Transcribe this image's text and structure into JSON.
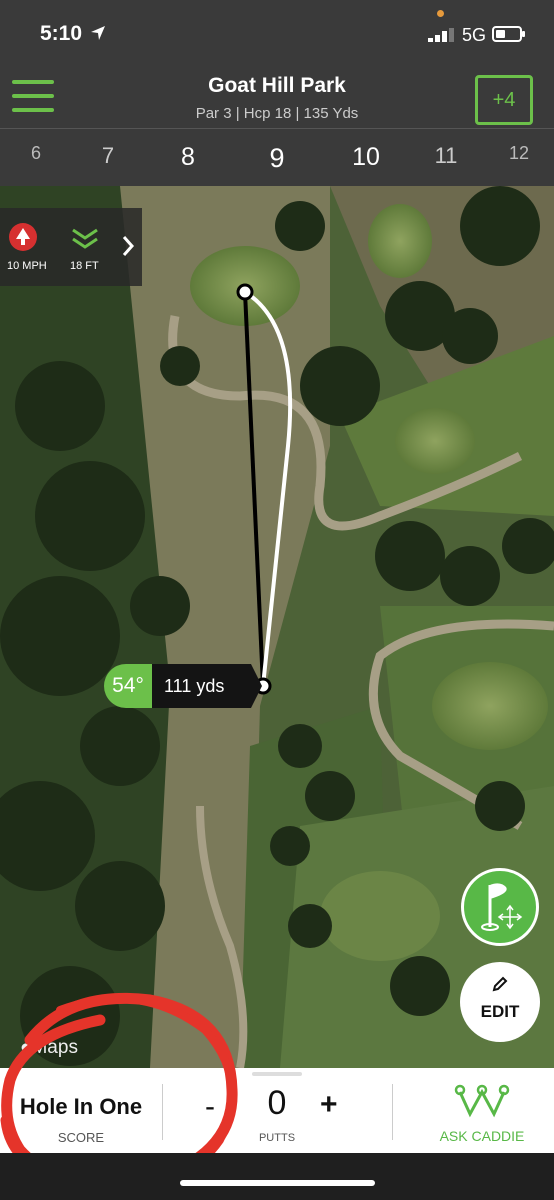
{
  "status": {
    "time": "5:10",
    "network": "5G"
  },
  "header": {
    "course": "Goat Hill Park",
    "subtitle": "Par 3 | Hcp 18 | 135 Yds",
    "score_badge": "+4"
  },
  "holes": [
    "6",
    "7",
    "8",
    "9",
    "10",
    "11",
    "12"
  ],
  "selected_hole": "9",
  "wind": {
    "speed": "10 MPH",
    "elevation": "18 FT"
  },
  "shot": {
    "angle": "54°",
    "distance": "111 yds"
  },
  "map": {
    "attribution": "Maps"
  },
  "edit_label": "EDIT",
  "bottom": {
    "score_value": "Hole In One",
    "score_label": "SCORE",
    "minus": "-",
    "putts_value": "0",
    "putts_label": "PUTTS",
    "plus": "+",
    "caddie_label": "ASK CADDIE"
  },
  "colors": {
    "accent": "#6cc04a",
    "bar_bg": "#3a3a3a",
    "annotation": "#e5342a"
  }
}
